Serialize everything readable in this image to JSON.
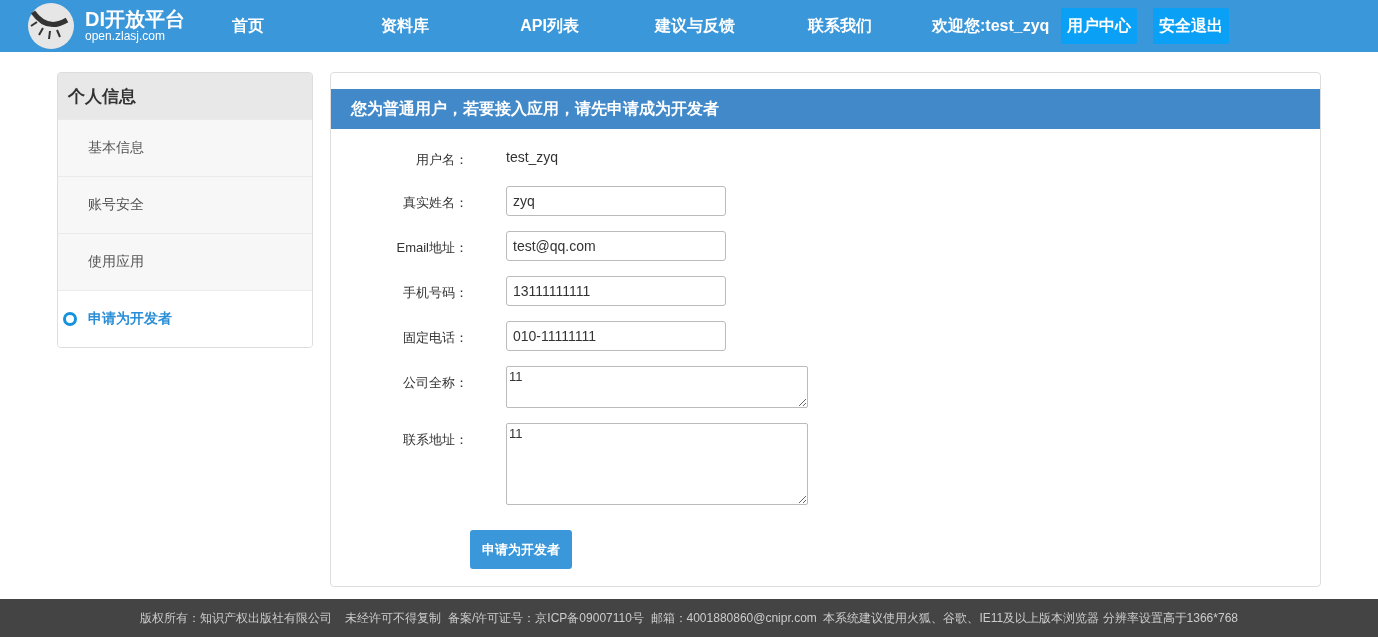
{
  "header": {
    "logo_title": "DI开放平台",
    "logo_subtitle": "open.zlasj.com",
    "nav": [
      {
        "label": "首页"
      },
      {
        "label": "资料库"
      },
      {
        "label": "API列表"
      },
      {
        "label": "建议与反馈"
      },
      {
        "label": "联系我们"
      }
    ],
    "welcome": "欢迎您:test_zyq",
    "buttons": [
      {
        "label": "用户中心"
      },
      {
        "label": "安全退出"
      }
    ]
  },
  "sidebar": {
    "title": "个人信息",
    "items": [
      {
        "label": "基本信息",
        "selected": false
      },
      {
        "label": "账号安全",
        "selected": false
      },
      {
        "label": "使用应用",
        "selected": false
      },
      {
        "label": "申请为开发者",
        "selected": true
      }
    ]
  },
  "panel": {
    "title": "您为普通用户，若要接入应用，请先申请成为开发者",
    "fields": [
      {
        "label": "用户名：",
        "kind": "text",
        "value": "test_zyq"
      },
      {
        "label": "真实姓名：",
        "kind": "input",
        "value": "zyq"
      },
      {
        "label": "Email地址：",
        "kind": "input",
        "value": "test@qq.com"
      },
      {
        "label": "手机号码：",
        "kind": "input",
        "value": "13111111111"
      },
      {
        "label": "固定电话：",
        "kind": "input",
        "value": "010-11111111"
      },
      {
        "label": "公司全称：",
        "kind": "memo",
        "value": "11"
      },
      {
        "label": "联系地址：",
        "kind": "textarea",
        "value": "11"
      }
    ],
    "submit": "申请为开发者"
  },
  "footer": "版权所有：知识产权出版社有限公司    未经许可不得复制  备案/许可证号：京ICP备09007110号  邮箱：4001880860@cnipr.com  本系统建议使用火狐、谷歌、IE11及以上版本浏览器 分辨率设置高于1366*768"
}
